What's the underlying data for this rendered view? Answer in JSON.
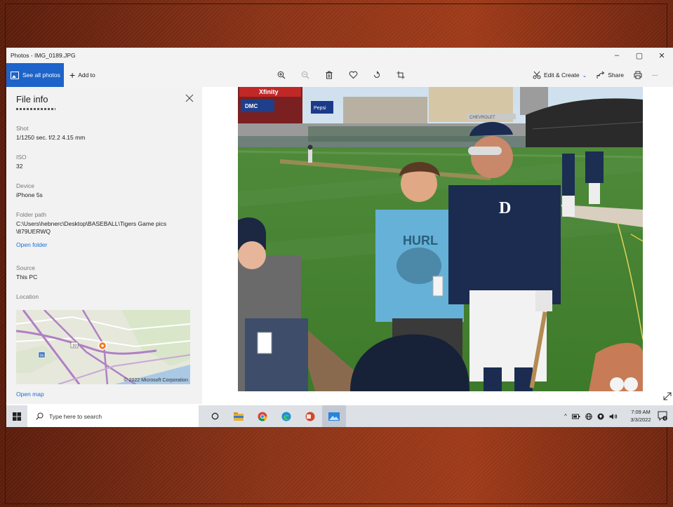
{
  "window": {
    "title": "Photos - IMG_0189.JPG",
    "minimize": "–",
    "maximize": "▢",
    "close": "✕"
  },
  "toolbar": {
    "see_all_photos": "See all photos",
    "add_to": "Add to",
    "edit_create": "Edit & Create",
    "share": "Share",
    "more": "···",
    "icons": [
      "zoom-in-icon",
      "zoom-out-icon",
      "delete-icon",
      "favorite-icon",
      "rotate-icon",
      "crop-icon"
    ]
  },
  "file_info": {
    "title": "File info",
    "shot_label": "Shot",
    "shot_value": "1/1250 sec. f/2.2 4.15 mm",
    "iso_label": "ISO",
    "iso_value": "32",
    "device_label": "Device",
    "device_value": "iPhone 5s",
    "folder_label": "Folder path",
    "folder_value_1": "C:\\Users\\hebnerc\\Desktop\\BASEBALL\\Tigers Game pics",
    "folder_value_2": "\\879UERWQ",
    "open_folder": "Open folder",
    "source_label": "Source",
    "source_value": "This PC",
    "location_label": "Location",
    "map_copyright": "© 2022 Microsoft Corporation",
    "map_road_label": "10",
    "map_highway_label": "96",
    "open_map": "Open map"
  },
  "photo": {
    "banner_text_1": "Xfinity",
    "banner_text_2": "Pepsi",
    "banner_text_3": "DMC",
    "scoreboard_text": "CHEVROLET",
    "shirt_text": "HURL",
    "jersey_logo": "D"
  },
  "taskbar": {
    "search_placeholder": "Type here to search",
    "time": "7:09 AM",
    "date": "3/3/2022",
    "notification_count": "4",
    "tray_chevron": "^"
  },
  "colors": {
    "accent": "#1d63c9",
    "link": "#1a6ed0",
    "panel_bg": "#f2f2f2",
    "taskbar_bg": "#dde1e6",
    "slide_bg": "#8a3317"
  }
}
